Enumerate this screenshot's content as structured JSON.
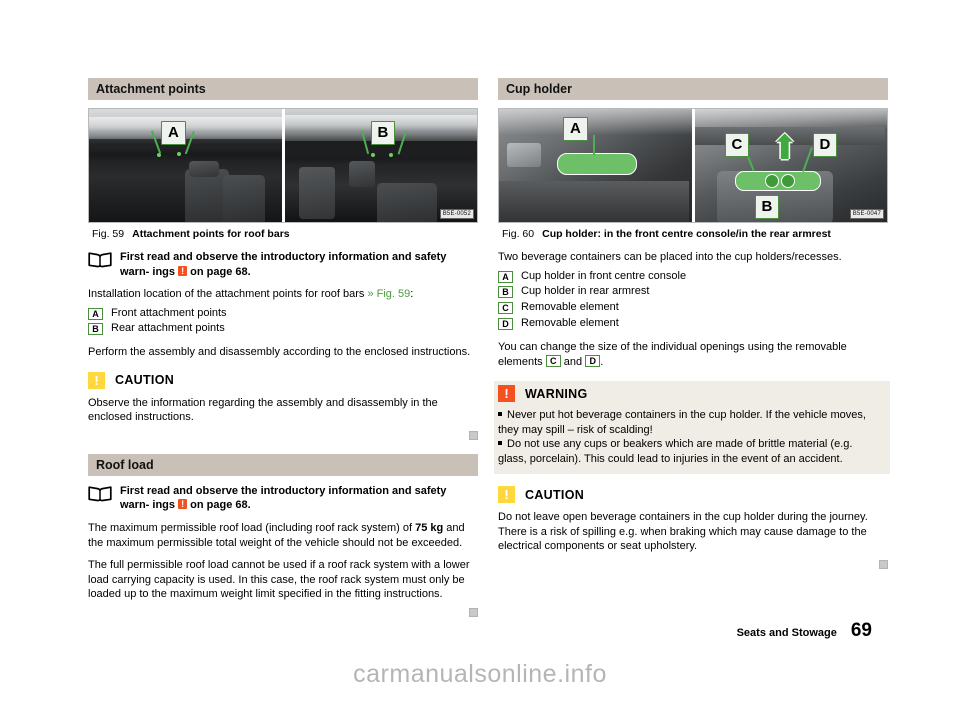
{
  "footer": {
    "section": "Seats and Stowage",
    "page_number": "69"
  },
  "watermark": "carmanualsonline.info",
  "colors": {
    "section_bar": "#c9c1b8",
    "warning_badge": "#f4511e",
    "caution_badge": "#ffd83d",
    "callout_green": "#4a8f3c",
    "cross_ref_green": "#4a9b3c",
    "note_box_bg": "#f0ece6"
  },
  "left_column": {
    "section1": {
      "heading": "Attachment points",
      "figure": {
        "number": "Fig. 59",
        "title": "Attachment points for roof bars",
        "image_code": "B5E-0052",
        "callouts": [
          "A",
          "B"
        ]
      },
      "read_first": {
        "line1": "First read and observe the introductory information and safety warn-",
        "line2_prefix": "ings",
        "line2_suffix": "on page 68.",
        "inline_badge": "!"
      },
      "intro": "Installation location of the attachment points for roof bars",
      "intro_ref": "» Fig. 59",
      "intro_colon": ":",
      "items": [
        {
          "letter": "A",
          "text": "Front attachment points"
        },
        {
          "letter": "B",
          "text": "Rear attachment points"
        }
      ],
      "paragraph": "Perform the assembly and disassembly according to the enclosed instructions.",
      "caution": {
        "title": "CAUTION",
        "badge": "!",
        "body": "Observe the information regarding the assembly and disassembly in the enclosed instructions."
      }
    },
    "section2": {
      "heading": "Roof load",
      "read_first": {
        "line1": "First read and observe the introductory information and safety warn-",
        "line2_prefix": "ings",
        "line2_suffix": "on page 68.",
        "inline_badge": "!"
      },
      "paragraph1_before": "The maximum permissible roof load (including roof rack system) of",
      "paragraph1_bold": "75 kg",
      "paragraph1_after": "and the maximum permissible total weight of the vehicle should not be exceeded.",
      "paragraph2": "The full permissible roof load cannot be used if a roof rack system with a lower load carrying capacity is used. In this case, the roof rack system must only be loaded up to the maximum weight limit specified in the fitting instructions."
    }
  },
  "right_column": {
    "section1": {
      "heading": "Cup holder",
      "figure": {
        "number": "Fig. 60",
        "title": "Cup holder: in the front centre console/in the rear armrest",
        "image_code": "B5E-0047",
        "callouts": [
          "A",
          "B",
          "C",
          "D"
        ]
      },
      "paragraph": "Two beverage containers can be placed into the cup holders/recesses.",
      "items": [
        {
          "letter": "A",
          "text": "Cup holder in front centre console"
        },
        {
          "letter": "B",
          "text": "Cup holder in rear armrest"
        },
        {
          "letter": "C",
          "text": "Removable element"
        },
        {
          "letter": "D",
          "text": "Removable element"
        }
      ],
      "closing_before": "You can change the size of the individual openings using the removable elements",
      "closing_letter1": "C",
      "closing_and": "and",
      "closing_letter2": "D",
      "closing_period": ".",
      "warning": {
        "title": "WARNING",
        "badge": "!",
        "bullets": [
          "Never put hot beverage containers in the cup holder. If the vehicle moves, they may spill – risk of scalding!",
          "Do not use any cups or beakers which are made of brittle material (e.g. glass, porcelain). This could lead to injuries in the event of an accident."
        ]
      },
      "caution": {
        "title": "CAUTION",
        "badge": "!",
        "body": "Do not leave open beverage containers in the cup holder during the journey. There is a risk of spilling e.g. when braking which may cause damage to the electrical components or seat upholstery."
      }
    }
  }
}
